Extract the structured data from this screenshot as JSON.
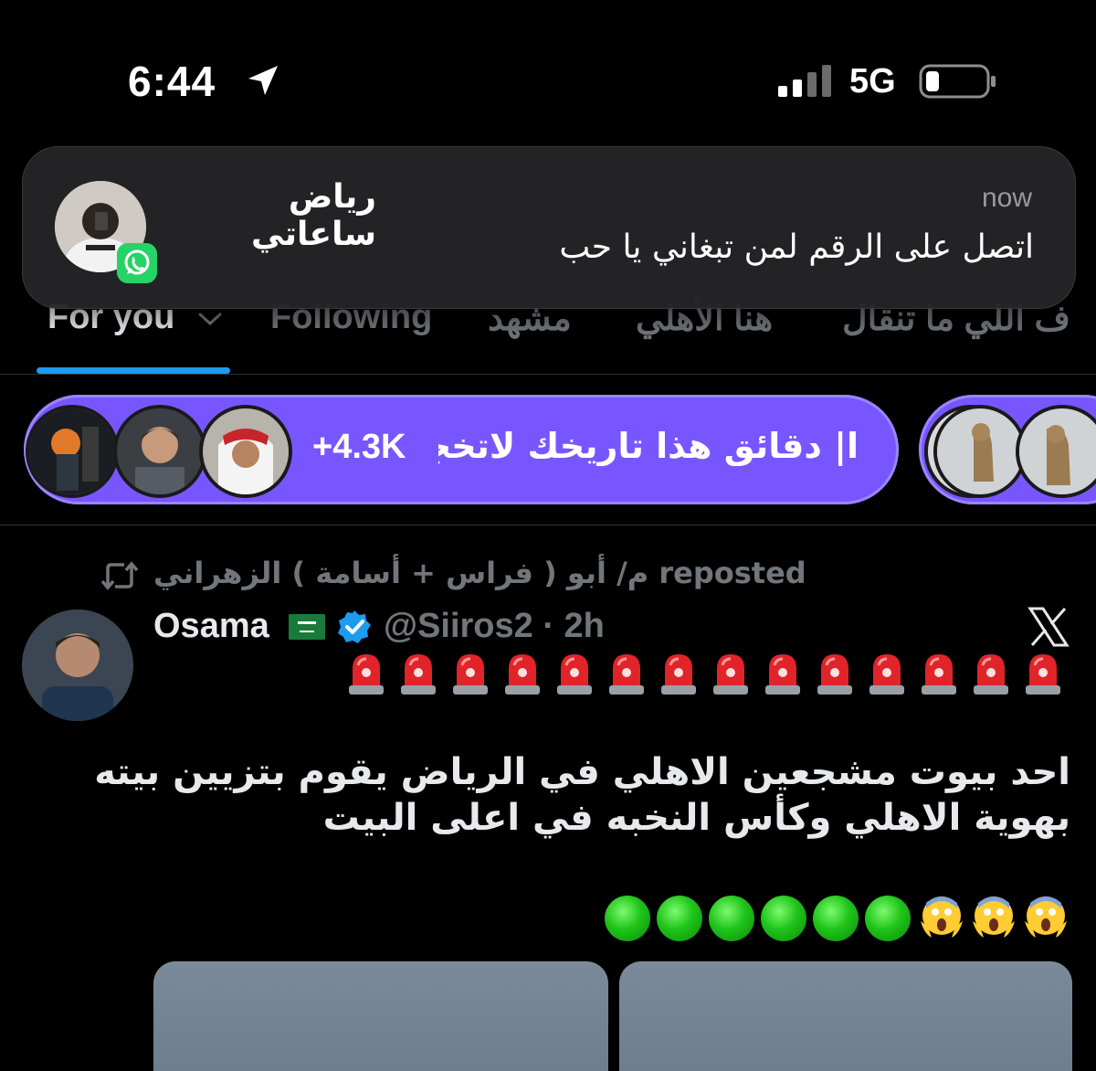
{
  "status_bar": {
    "time": "6:44",
    "network": "5G"
  },
  "notification": {
    "sender": "رياض ساعاتي",
    "time": "now",
    "message": "اتصل على الرقم لمن تبغاني يا حب",
    "app_icon": "whatsapp-icon"
  },
  "tabs": [
    {
      "label": "For you",
      "active": true
    },
    {
      "label": "Following",
      "active": false
    },
    {
      "label": "مشهد",
      "active": false
    },
    {
      "label": "هنا الأهلي",
      "active": false
    },
    {
      "label": "ف اللي ما تنقال",
      "active": false
    }
  ],
  "space": {
    "listener_count": "+4.3K",
    "title": "ا| دقائق هذا تاريخك لاتخجل"
  },
  "post": {
    "repost_label": "م/ أبو ( فراس + أسامة ) الزهراني reposted",
    "author_name": "Osama",
    "handle_time": "@Siiros2 · 2h",
    "text_line_1": "احد بيوت مشجعين الاهلي في الرياض يقوم بتزيين بيته",
    "text_line_2": "بهوية الاهلي وكأس النخبه في اعلى البيت",
    "siren_count": 14,
    "green_circle_count": 6,
    "scream_count": 3
  },
  "colors": {
    "accent": "#1d9bf0",
    "space_purple": "#7856ff",
    "muted_text": "#71767b",
    "whatsapp_green": "#25d366"
  }
}
